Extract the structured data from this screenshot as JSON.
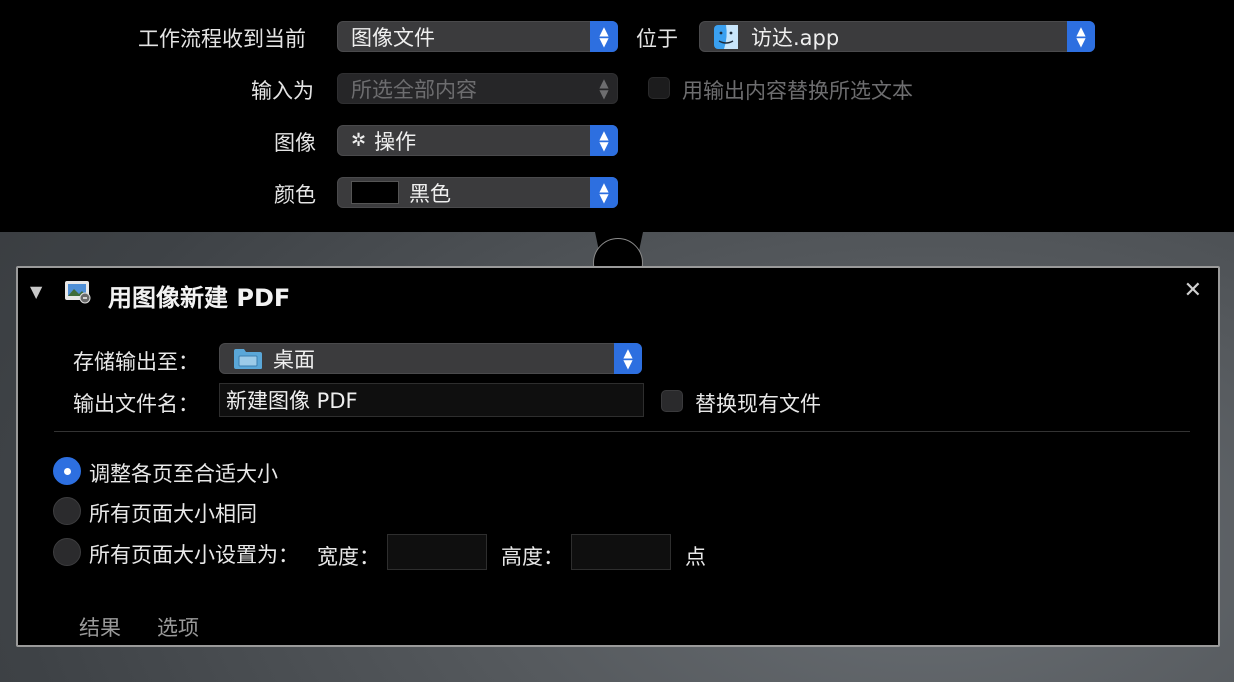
{
  "workflow": {
    "receives_label": "工作流程收到当前",
    "receives_value": "图像文件",
    "in_label": "位于",
    "in_value": "访达.app",
    "input_label": "输入为",
    "input_value": "所选全部内容",
    "replace_selected_label": "用输出内容替换所选文本",
    "image_label": "图像",
    "image_value": "操作",
    "color_label": "颜色",
    "color_value": "黑色",
    "color_swatch": "#000000"
  },
  "action": {
    "title": "用图像新建 PDF",
    "save_to_label": "存储输出至：",
    "save_to_value": "桌面",
    "filename_label": "输出文件名：",
    "filename_value": "新建图像 PDF",
    "replace_existing_label": "替换现有文件",
    "options": [
      {
        "label": "调整各页至合适大小",
        "selected": true
      },
      {
        "label": "所有页面大小相同",
        "selected": false
      },
      {
        "label": "所有页面大小设置为：",
        "selected": false
      }
    ],
    "width_label": "宽度：",
    "width_value": "",
    "height_label": "高度：",
    "height_value": "",
    "unit_label": "点",
    "tabs": [
      "结果",
      "选项"
    ]
  },
  "colors": {
    "accent": "#2d6fe0",
    "panel_border": "#9a9a9a"
  }
}
